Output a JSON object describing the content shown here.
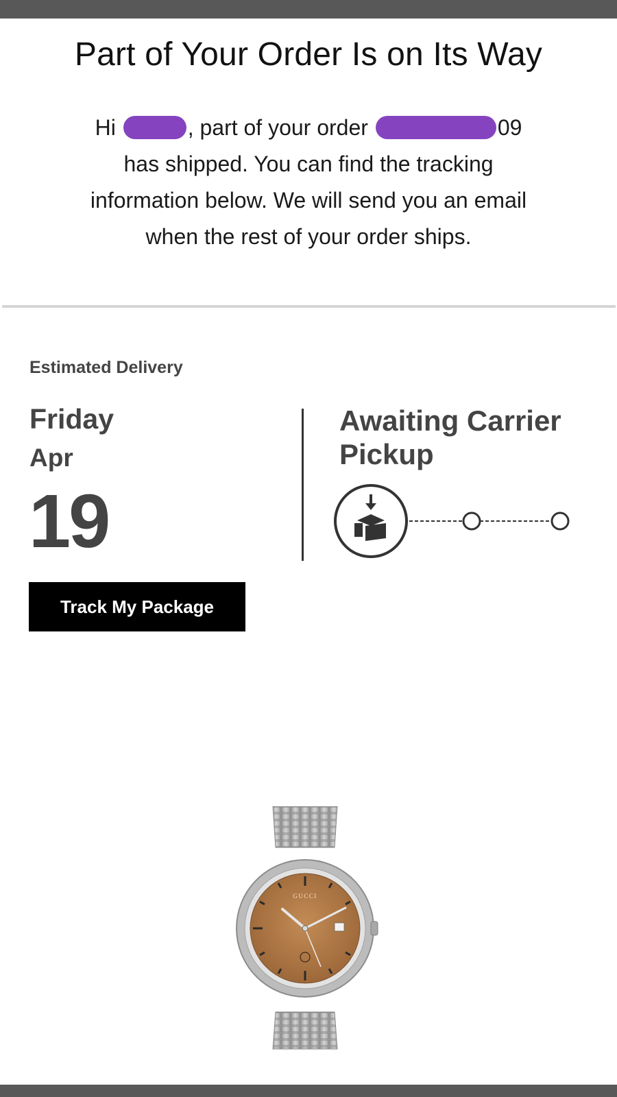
{
  "email": {
    "headline": "Part of Your Order Is on Its Way",
    "greeting_prefix": "Hi",
    "greeting_middle": ", part of your order",
    "order_suffix": "09",
    "body_text": "has shipped. You can find the tracking information below. We will send you an email when the rest of your order ships."
  },
  "delivery": {
    "label": "Estimated Delivery",
    "weekday": "Friday",
    "month": "Apr",
    "day": "19",
    "status": "Awaiting Carrier Pickup",
    "track_button": "Track My Package"
  },
  "tracker": {
    "icons": [
      "package-pickup-icon",
      "step-circle-icon",
      "step-circle-icon"
    ],
    "current_step": 1,
    "total_steps": 3
  },
  "colors": {
    "redaction": "#8543c0",
    "button_bg": "#000000",
    "button_text": "#ffffff",
    "text_gray": "#444444",
    "divider": "#d5d5d5",
    "dial": "#b07a45"
  },
  "product": {
    "image": "wristwatch-image",
    "dial_brand": "GUCCI"
  }
}
